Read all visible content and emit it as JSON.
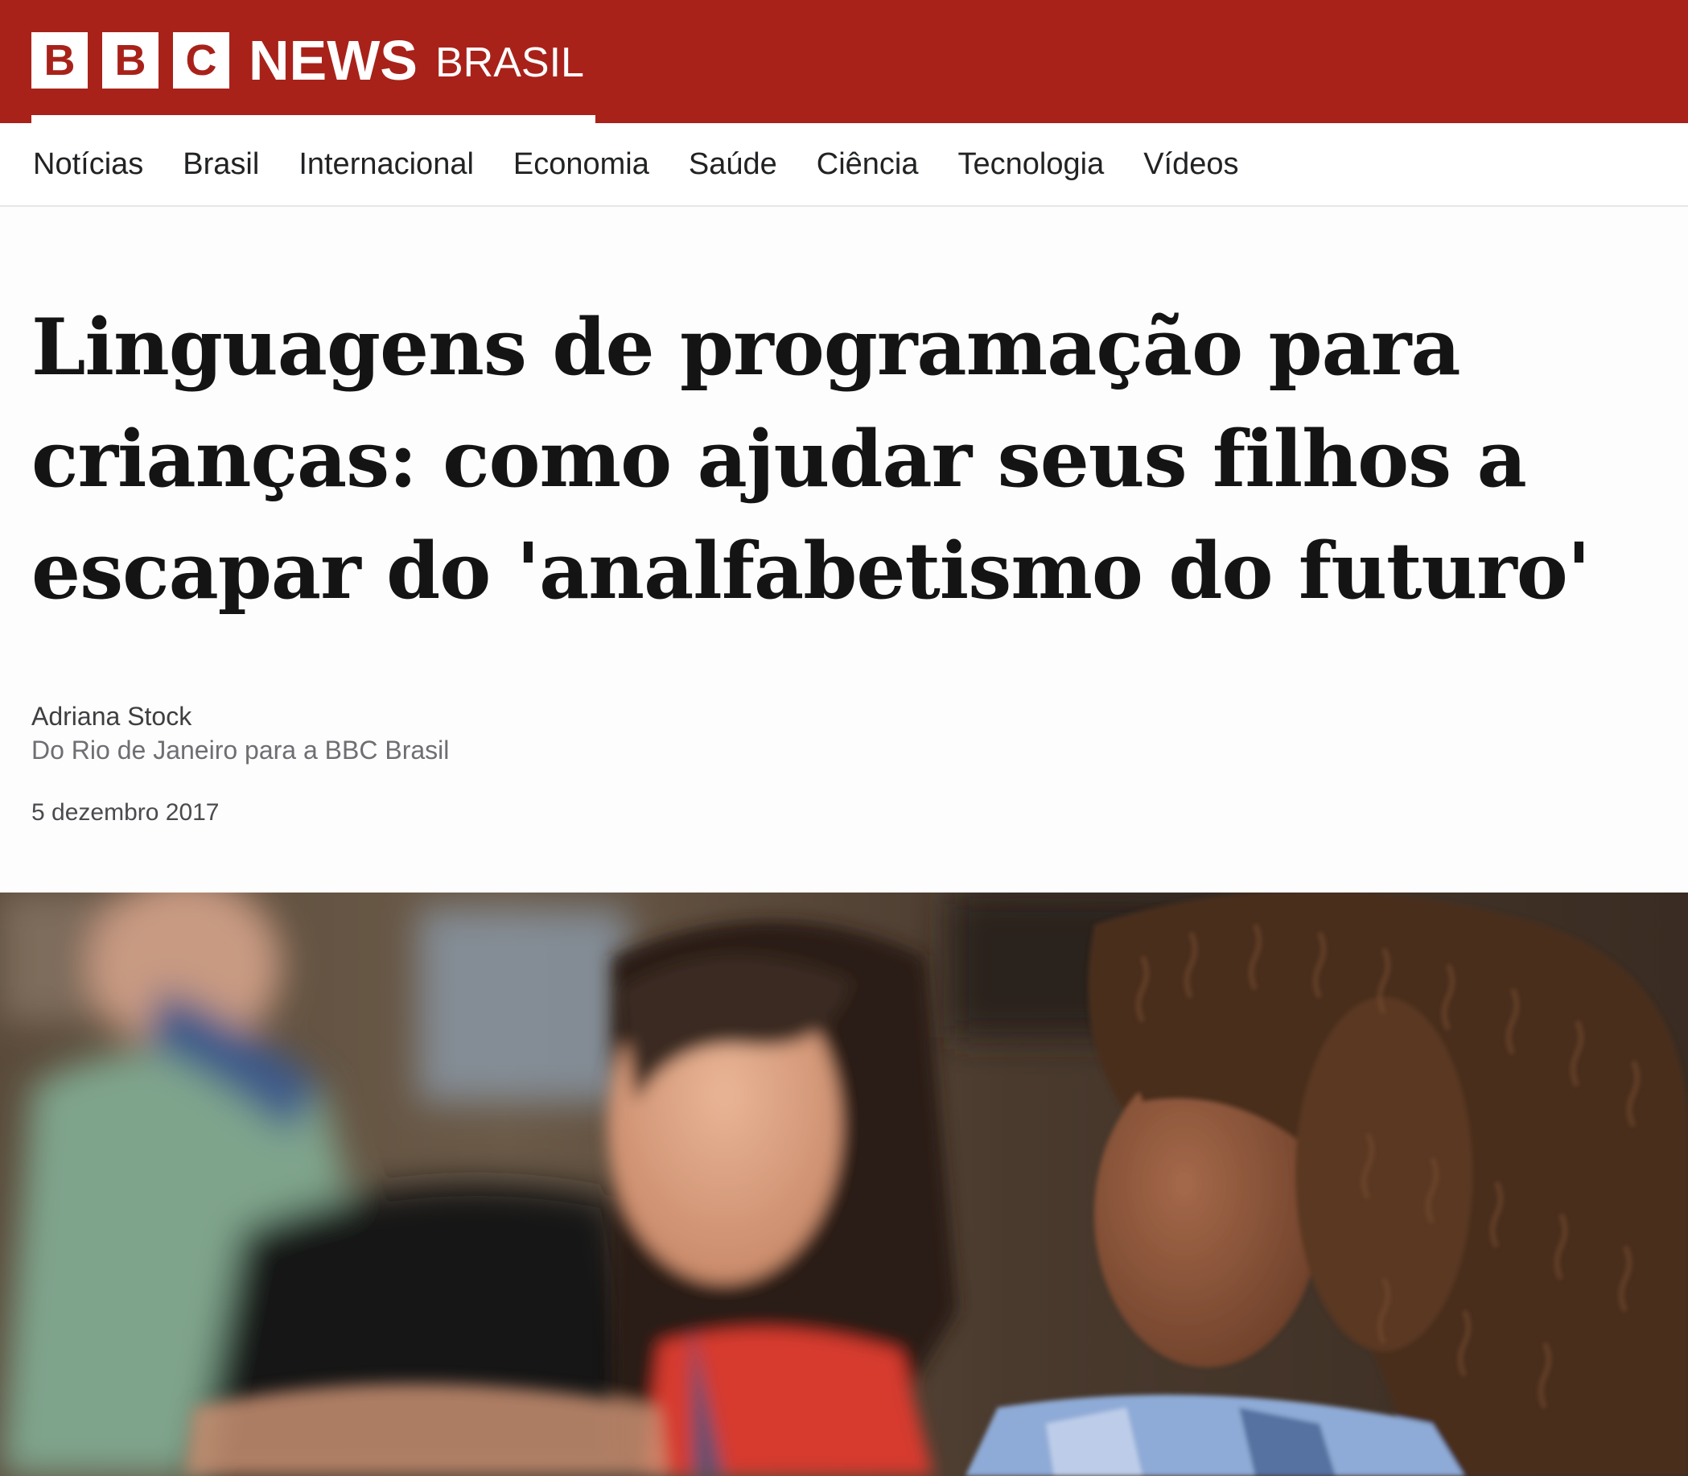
{
  "header": {
    "logo_letters": [
      "B",
      "B",
      "C"
    ],
    "news_label": "NEWS",
    "edition_label": "BRASIL",
    "background_color": "#a8221a"
  },
  "nav": {
    "items": [
      {
        "label": "Notícias"
      },
      {
        "label": "Brasil"
      },
      {
        "label": "Internacional"
      },
      {
        "label": "Economia"
      },
      {
        "label": "Saúde"
      },
      {
        "label": "Ciência"
      },
      {
        "label": "Tecnologia"
      },
      {
        "label": "Vídeos"
      }
    ]
  },
  "article": {
    "headline": "Linguagens de programação para crianças: como ajudar seus filhos a escapar do 'analfabetismo do futuro'",
    "author": "Adriana Stock",
    "author_role": "Do Rio de Janeiro para a BBC Brasil",
    "date": "5 dezembro 2017"
  },
  "hero_image": {
    "icon": "photo-children-at-computers"
  }
}
